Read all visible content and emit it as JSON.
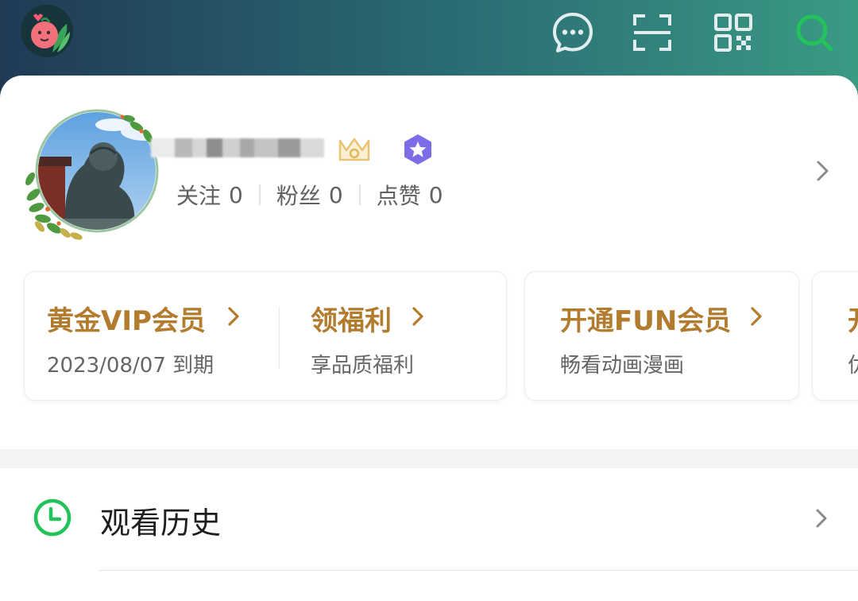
{
  "header": {
    "icons": [
      "chat-icon",
      "scan-icon",
      "qr-code-icon",
      "search-icon"
    ],
    "search_icon_color": "#22c35a"
  },
  "profile": {
    "stats": [
      {
        "label": "关注",
        "value": "0"
      },
      {
        "label": "粉丝",
        "value": "0"
      },
      {
        "label": "点赞",
        "value": "0"
      }
    ]
  },
  "cards": [
    {
      "title": "黄金VIP会员",
      "subtitle": "2023/08/07  到期"
    },
    {
      "title": "领福利",
      "subtitle": "享品质福利"
    },
    {
      "title": "开通FUN会员",
      "subtitle": "畅看动画漫画"
    },
    {
      "title": "开",
      "subtitle": "优"
    }
  ],
  "menu": {
    "history_label": "观看历史"
  },
  "colors": {
    "accent_gold": "#b27b2e",
    "accent_green": "#22c35a",
    "header_gradient_start": "#203a56",
    "header_gradient_end": "#3a9a84"
  }
}
